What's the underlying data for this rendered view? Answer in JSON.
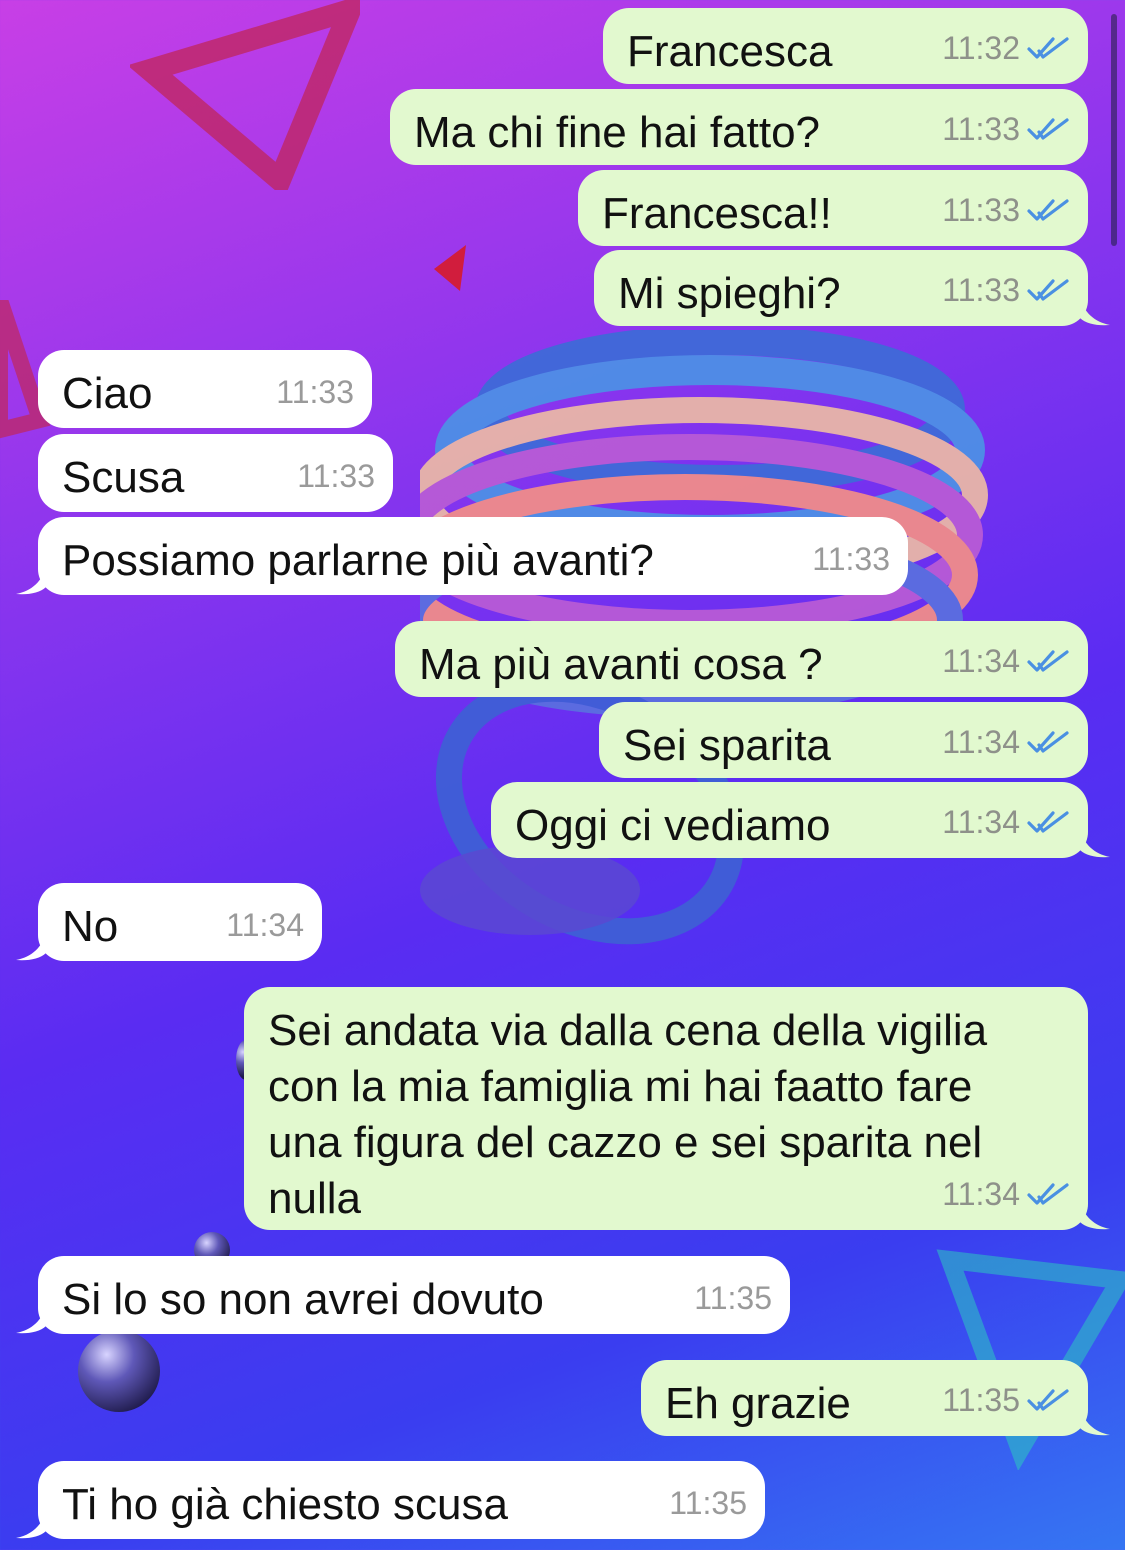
{
  "conversation": {
    "messages": [
      {
        "dir": "out",
        "text": "Francesca",
        "time": "11:32",
        "read": true
      },
      {
        "dir": "out",
        "text": "Ma chi fine hai fatto?",
        "time": "11:33",
        "read": true
      },
      {
        "dir": "out",
        "text": "Francesca!!",
        "time": "11:33",
        "read": true
      },
      {
        "dir": "out",
        "text": "Mi spieghi?",
        "time": "11:33",
        "read": true
      },
      {
        "dir": "in",
        "text": "Ciao",
        "time": "11:33"
      },
      {
        "dir": "in",
        "text": "Scusa",
        "time": "11:33"
      },
      {
        "dir": "in",
        "text": "Possiamo parlarne più avanti?",
        "time": "11:33"
      },
      {
        "dir": "out",
        "text": "Ma più avanti cosa ?",
        "time": "11:34",
        "read": true
      },
      {
        "dir": "out",
        "text": "Sei sparita",
        "time": "11:34",
        "read": true
      },
      {
        "dir": "out",
        "text": "Oggi ci vediamo",
        "time": "11:34",
        "read": true
      },
      {
        "dir": "in",
        "text": "No",
        "time": "11:34"
      },
      {
        "dir": "out",
        "text": "Sei andata via dalla cena della vigilia\ncon la mia famiglia mi hai faatto fare\nuna figura del cazzo e sei sparita nel\nnulla",
        "time": "11:34",
        "read": true
      },
      {
        "dir": "in",
        "text": "Si lo so non avrei dovuto",
        "time": "11:35"
      },
      {
        "dir": "out",
        "text": "Eh grazie",
        "time": "11:35",
        "read": true
      },
      {
        "dir": "in",
        "text": "Ti ho già chiesto scusa",
        "time": "11:35"
      }
    ]
  },
  "colors": {
    "outgoing_bubble": "#e2f9cf",
    "incoming_bubble": "#ffffff",
    "read_ticks": "#4a90e2"
  }
}
